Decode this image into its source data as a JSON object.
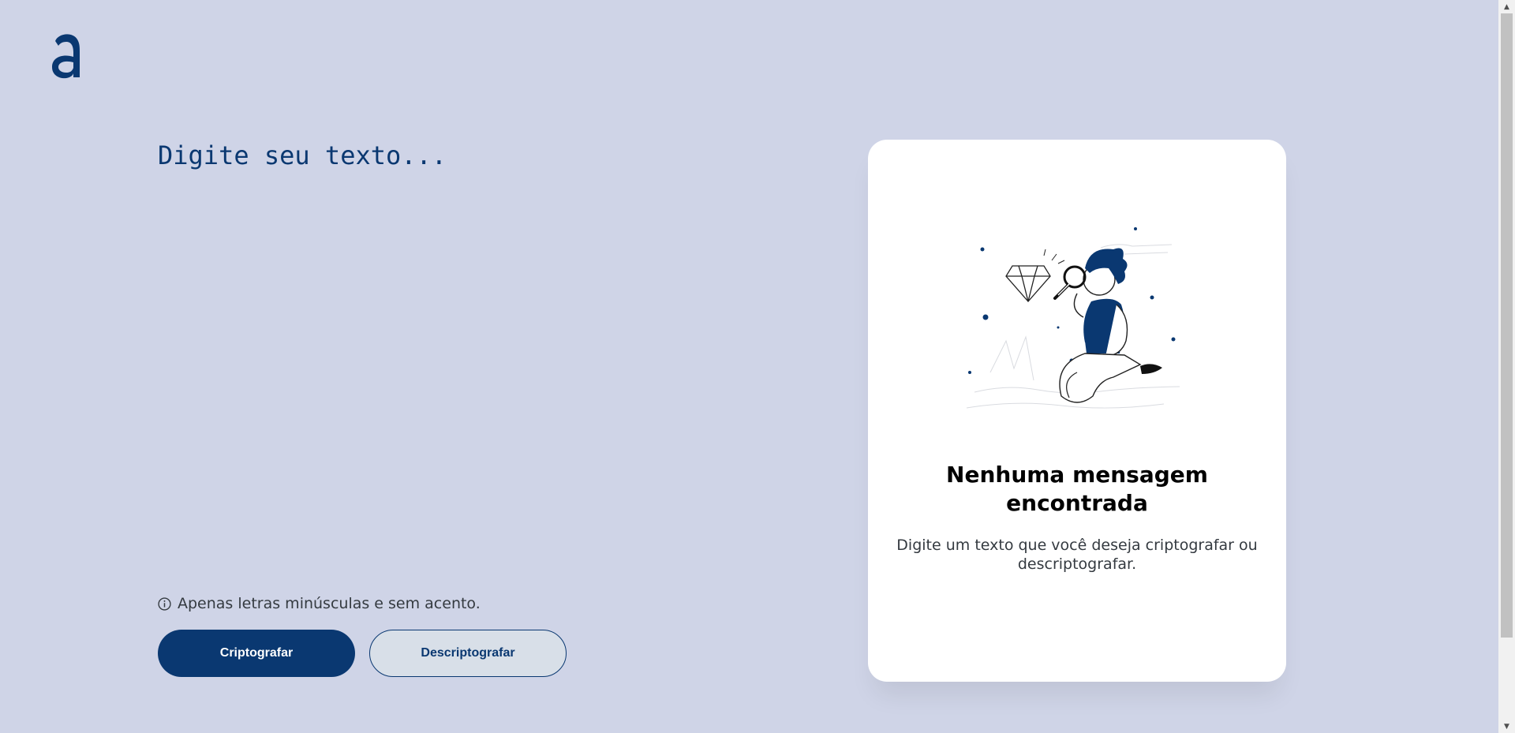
{
  "app": {
    "logo_icon": "alura-a-logo-icon"
  },
  "editor": {
    "placeholder": "Digite seu texto...",
    "value": ""
  },
  "hint": {
    "icon": "info-icon",
    "text": "Apenas letras minúsculas e sem acento."
  },
  "actions": {
    "encrypt_label": "Criptografar",
    "decrypt_label": "Descriptografar"
  },
  "result": {
    "illustration": "man-with-magnifying-glass-diamond-illustration",
    "title": "Nenhuma mensagem encontrada",
    "message": "Digite um texto que você deseja criptografar ou descriptografar."
  },
  "colors": {
    "background": "#cfd4e7",
    "primary": "#0a3871",
    "card": "#ffffff"
  }
}
